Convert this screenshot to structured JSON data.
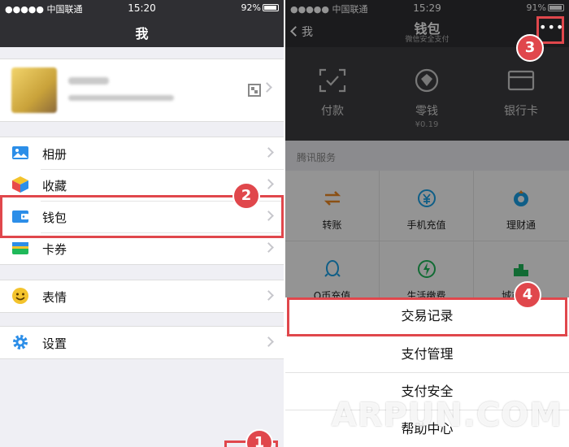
{
  "left": {
    "status": {
      "carrier": "●●●●● 中国联通",
      "time": "15:20",
      "battery": "92%"
    },
    "title": "我",
    "menu": [
      {
        "label": "相册",
        "icon": "photo-icon"
      },
      {
        "label": "收藏",
        "icon": "favorites-cube-icon"
      },
      {
        "label": "钱包",
        "icon": "wallet-icon"
      },
      {
        "label": "卡券",
        "icon": "card-coupon-icon"
      },
      {
        "label": "表情",
        "icon": "smiley-icon"
      },
      {
        "label": "设置",
        "icon": "gear-icon"
      }
    ]
  },
  "right": {
    "status": {
      "carrier": "●●●●● 中国联通",
      "time": "15:29",
      "battery": "91%"
    },
    "back_label": "我",
    "title": "钱包",
    "subtitle": "微信安全支付",
    "more_label": "•••",
    "wallet": [
      {
        "label": "付款",
        "sub": "",
        "icon": "scan-pay-icon"
      },
      {
        "label": "零钱",
        "sub": "¥0.19",
        "icon": "change-icon"
      },
      {
        "label": "银行卡",
        "sub": "",
        "icon": "bank-card-icon"
      }
    ],
    "section_title": "腾讯服务",
    "services": [
      {
        "label": "转账",
        "icon": "transfer-icon"
      },
      {
        "label": "手机充值",
        "icon": "phone-recharge-icon"
      },
      {
        "label": "理财通",
        "icon": "wealth-icon"
      },
      {
        "label": "Q币充值",
        "icon": "qq-coin-icon"
      },
      {
        "label": "生活缴费",
        "icon": "utility-icon"
      },
      {
        "label": "城市服务",
        "icon": "city-icon"
      }
    ],
    "sheet": [
      "交易记录",
      "支付管理",
      "支付安全",
      "帮助中心"
    ]
  },
  "badges": [
    "1",
    "2",
    "3",
    "4"
  ],
  "watermark": "ARPUN.COM",
  "colors": {
    "highlight": "#e0474c",
    "navbar": "#2f2f33",
    "wallet_bg": "#3d3d40",
    "orange": "#f08a24",
    "blue": "#1aa3e8",
    "green": "#1fb95a"
  }
}
